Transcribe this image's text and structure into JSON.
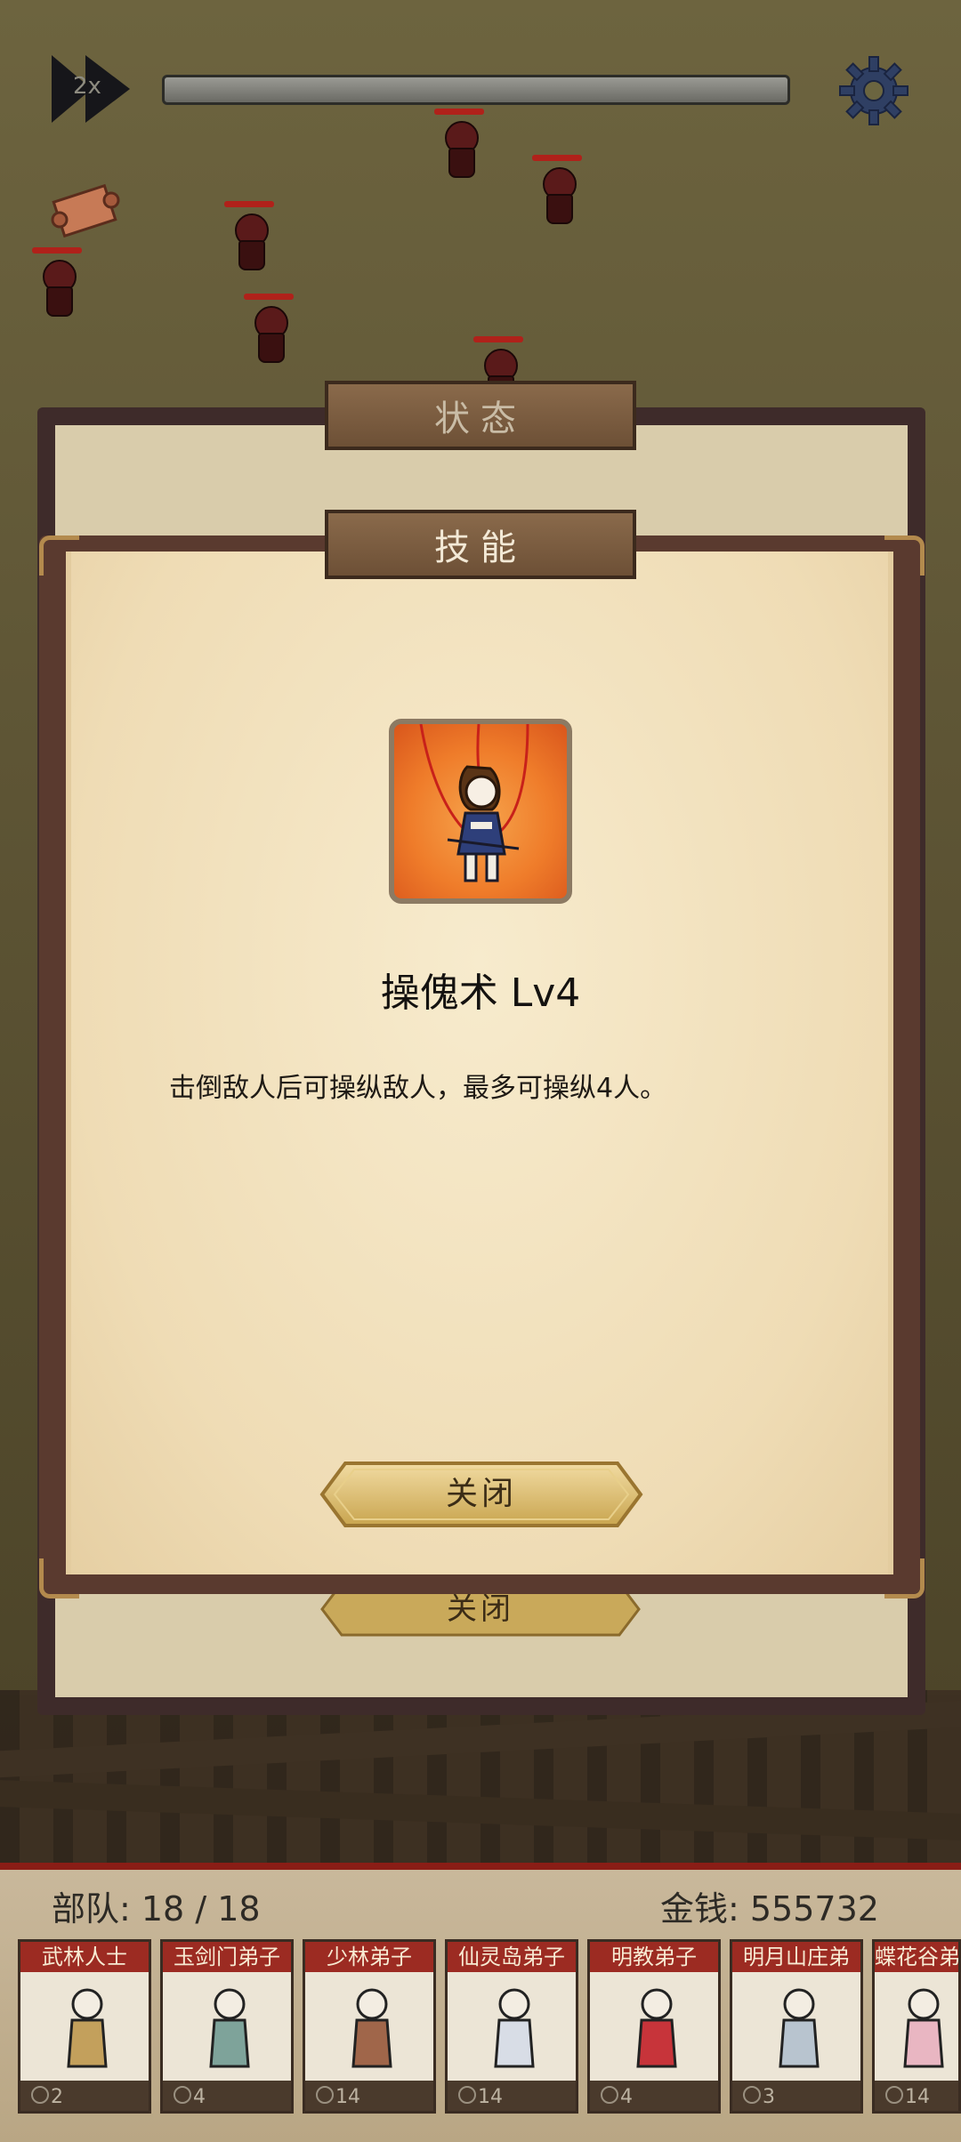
{
  "hud": {
    "speed_label": "2x",
    "wave_progress": 1.0
  },
  "status_tab": {
    "label": "状态"
  },
  "skill_tab": {
    "label": "技能"
  },
  "skill": {
    "name": "操傀术 Lv4",
    "description": "击倒敌人后可操纵敌人，最多可操纵4人。",
    "icon": "puppet-skill-icon"
  },
  "buttons": {
    "close_label": "关闭",
    "back_close_label": "关闭"
  },
  "roster": {
    "troops_label": "部队:  18 / 18",
    "gold_label": "金钱:  555732",
    "units": [
      {
        "name": "武林人士",
        "cost": "2"
      },
      {
        "name": "玉剑门弟子",
        "cost": "4"
      },
      {
        "name": "少林弟子",
        "cost": "14"
      },
      {
        "name": "仙灵岛弟子",
        "cost": "14"
      },
      {
        "name": "明教弟子",
        "cost": "4"
      },
      {
        "name": "明月山庄弟",
        "cost": "3"
      },
      {
        "name": "蝶花谷弟",
        "cost": "14"
      }
    ]
  },
  "colors": {
    "enemy": "#5a1a1a",
    "hp_bar": "#b0211a",
    "card_header": "#9c2b22",
    "paper": "#efdcb5"
  }
}
